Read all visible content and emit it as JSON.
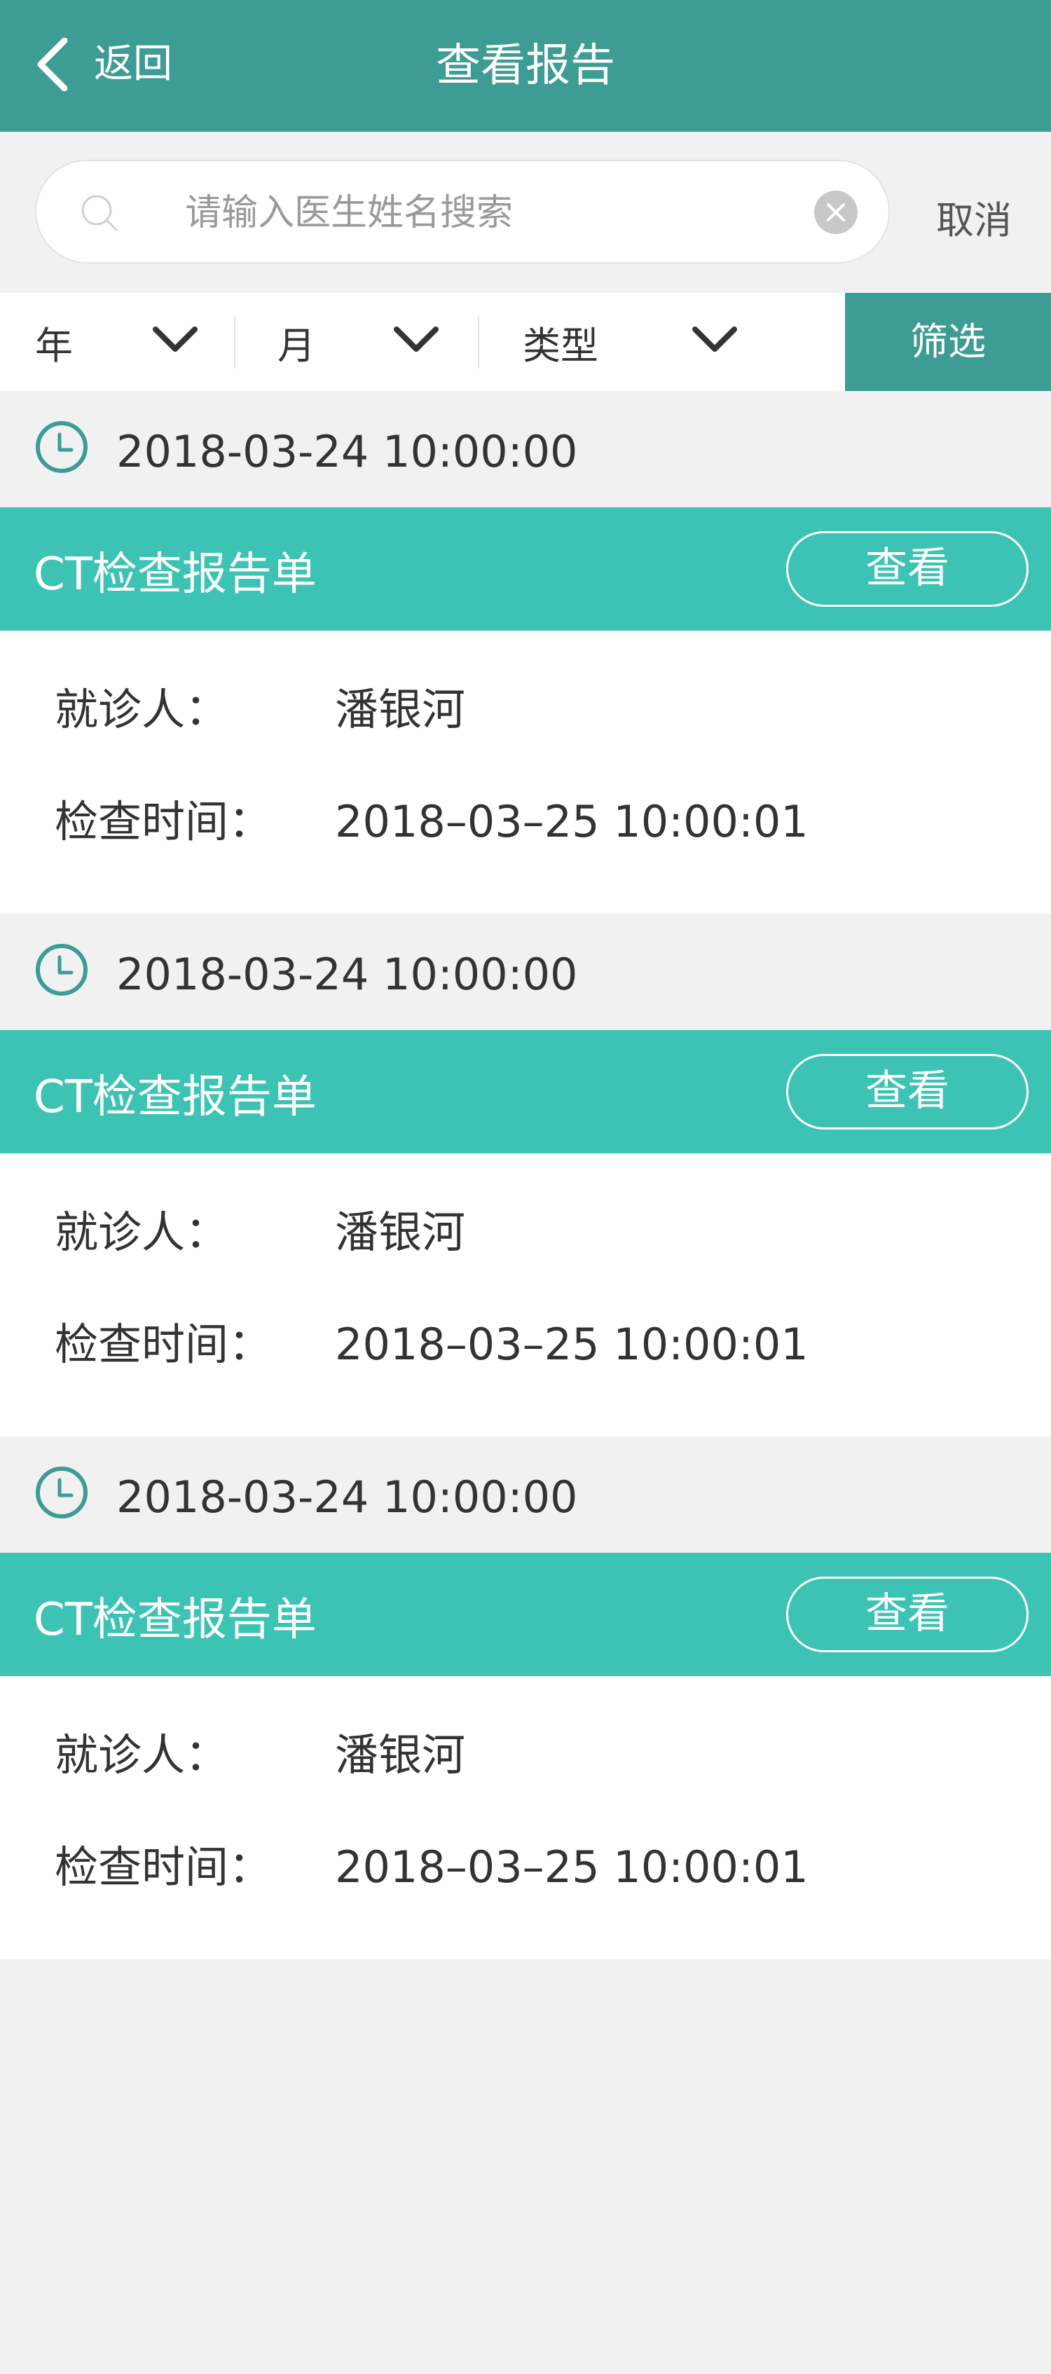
{
  "header": {
    "back_label": "返回",
    "title": "查看报告"
  },
  "search": {
    "placeholder": "请输入医生姓名搜索",
    "value": "",
    "cancel_label": "取消"
  },
  "filters": {
    "year_label": "年",
    "month_label": "月",
    "type_label": "类型",
    "apply_label": "筛选"
  },
  "colors": {
    "header_bg": "#3d9c93",
    "card_head_bg": "#3cc3b4",
    "page_bg": "#f1f1f1"
  },
  "records": [
    {
      "date": "2018-03-24 10:00:00",
      "title": "CT检查报告单",
      "view_label": "查看",
      "patient_label": "就诊人：",
      "patient": "潘银河",
      "time_label": "检查时间：",
      "time": "2018–03–25 10:00:01"
    },
    {
      "date": "2018-03-24 10:00:00",
      "title": "CT检查报告单",
      "view_label": "查看",
      "patient_label": "就诊人：",
      "patient": "潘银河",
      "time_label": "检查时间：",
      "time": "2018–03–25 10:00:01"
    },
    {
      "date": "2018-03-24 10:00:00",
      "title": "CT检查报告单",
      "view_label": "查看",
      "patient_label": "就诊人：",
      "patient": "潘银河",
      "time_label": "检查时间：",
      "time": "2018–03–25 10:00:01"
    }
  ]
}
